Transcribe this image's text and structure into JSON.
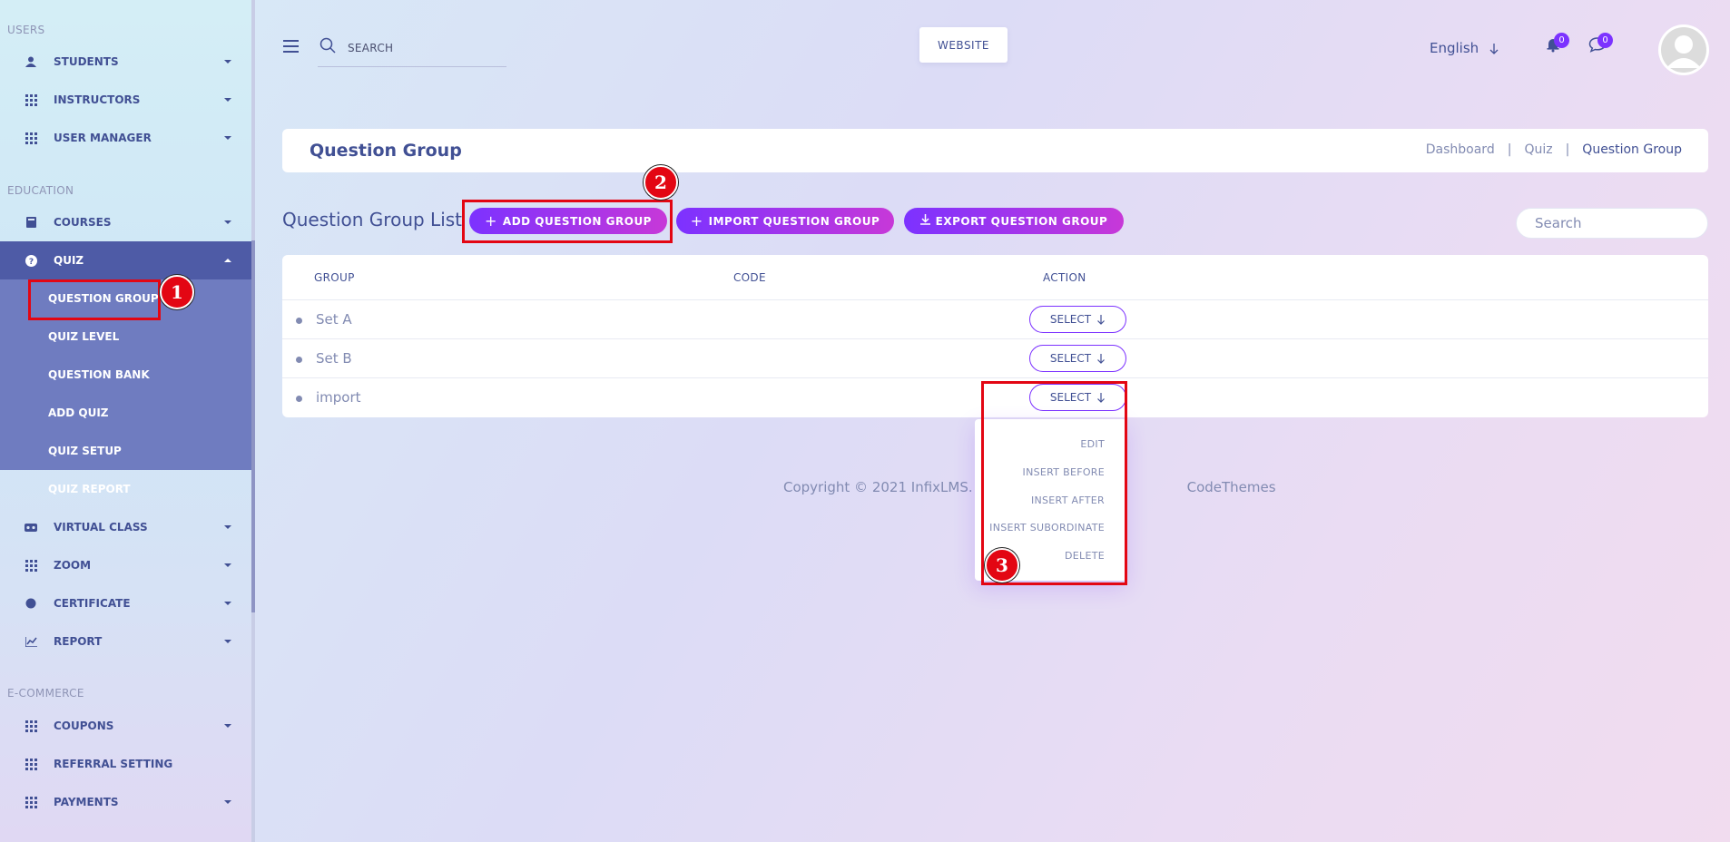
{
  "sidebar": {
    "sections": {
      "users": "USERS",
      "education": "EDUCATION",
      "ecommerce": "E-COMMERCE"
    },
    "items": {
      "students": "STUDENTS",
      "instructors": "INSTRUCTORS",
      "user_manager": "USER MANAGER",
      "courses": "COURSES",
      "quiz": "QUIZ",
      "virtual_class": "VIRTUAL CLASS",
      "zoom": "ZOOM",
      "certificate": "CERTIFICATE",
      "report": "REPORT",
      "coupons": "COUPONS",
      "referral_setting": "REFERRAL SETTING",
      "payments": "PAYMENTS"
    },
    "quiz_submenu": {
      "question_group": "QUESTION GROUP",
      "quiz_level": "QUIZ LEVEL",
      "question_bank": "QUESTION BANK",
      "add_quiz": "ADD QUIZ",
      "quiz_setup": "QUIZ SETUP",
      "quiz_report": "QUIZ REPORT"
    }
  },
  "topbar": {
    "search_placeholder": "SEARCH",
    "website_label": "WEBSITE",
    "language": "English",
    "notification_count": "0",
    "message_count": "0"
  },
  "page": {
    "title": "Question Group",
    "breadcrumb": [
      "Dashboard",
      "|",
      "Quiz",
      "|",
      "Question Group"
    ]
  },
  "list": {
    "title": "Question Group List",
    "add_button": "ADD QUESTION GROUP",
    "import_button": "IMPORT QUESTION GROUP",
    "export_button": "EXPORT QUESTION GROUP",
    "search_placeholder": "Search",
    "columns": [
      "GROUP",
      "CODE",
      "ACTION"
    ],
    "rows": [
      {
        "group": "Set A",
        "code": "",
        "action": "SELECT"
      },
      {
        "group": "Set B",
        "code": "",
        "action": "SELECT"
      },
      {
        "group": "import",
        "code": "",
        "action": "SELECT"
      }
    ]
  },
  "dropdown": {
    "items": [
      "EDIT",
      "INSERT BEFORE",
      "INSERT AFTER",
      "INSERT SUBORDINATE",
      "DELETE"
    ]
  },
  "footer": {
    "copyright_start": "Copyright © 2021 InfixLMS. All rig",
    "copyright_end": "CodeThemes"
  },
  "annotations": {
    "marker_1": "1",
    "marker_2": "2",
    "marker_3": "3"
  },
  "colors": {
    "accent": "#7c32ff",
    "accent2": "#c738d8",
    "primary_text": "#415094",
    "highlight": "#e30613"
  }
}
